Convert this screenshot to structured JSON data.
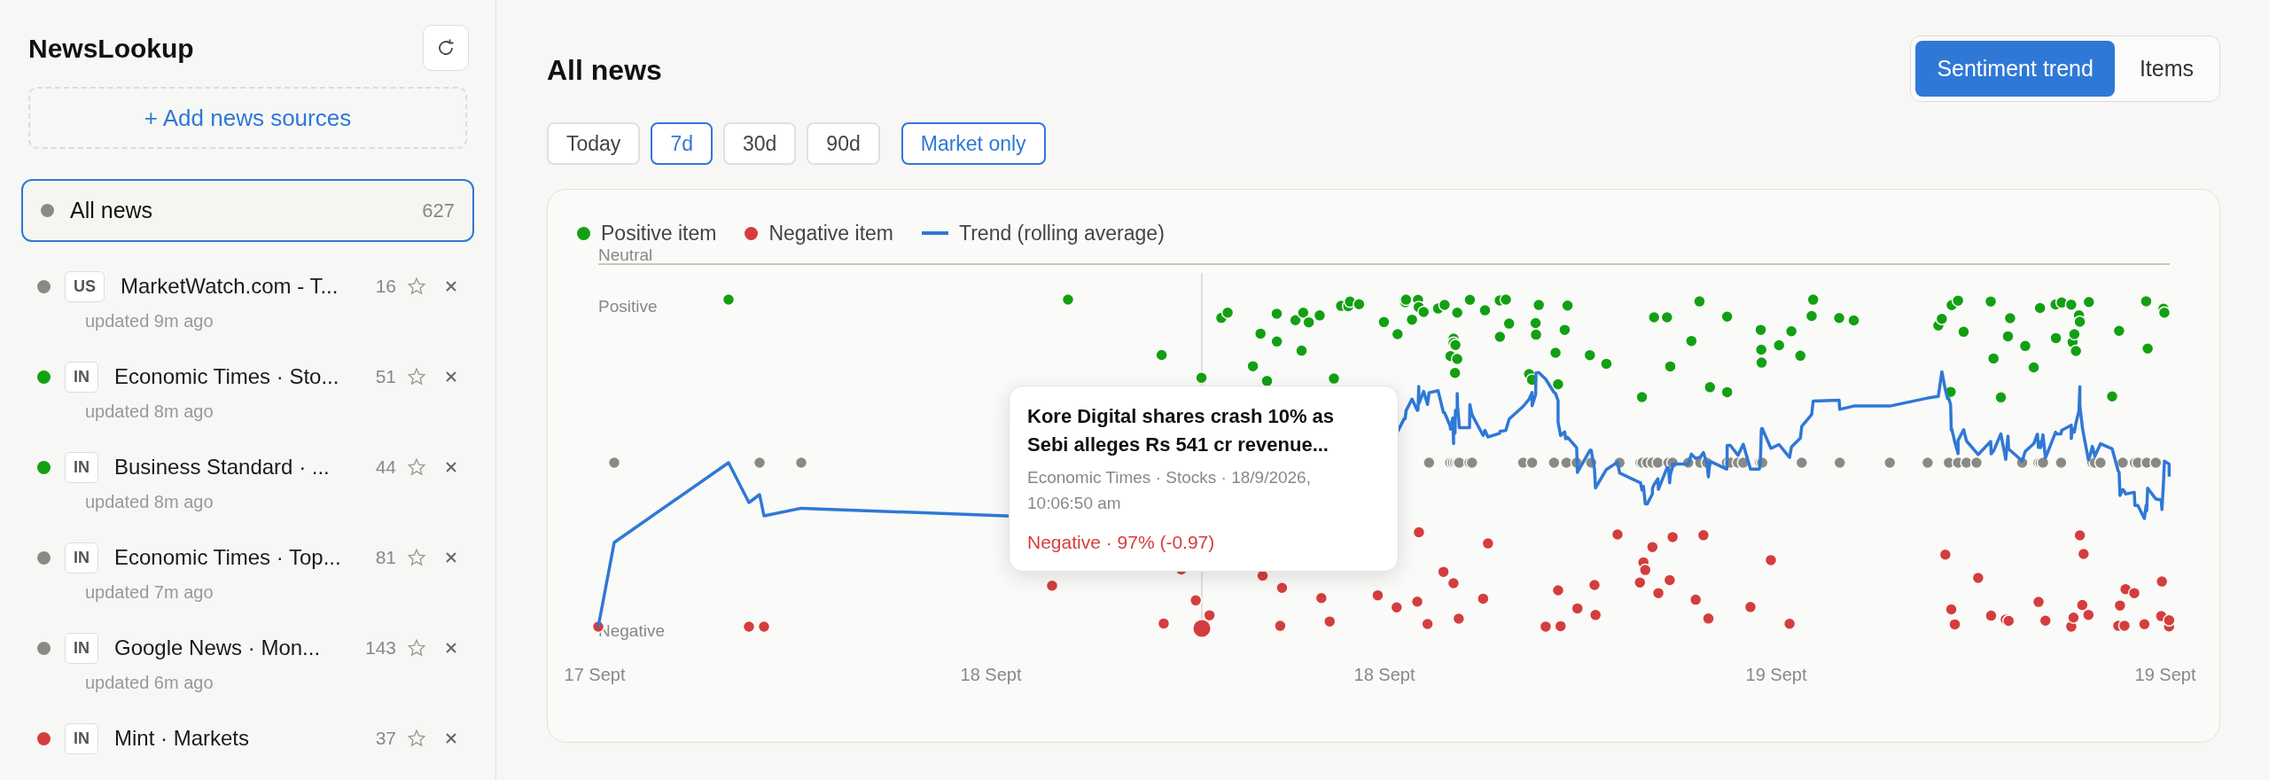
{
  "sidebar": {
    "title": "NewsLookup",
    "add_button": "+ Add news sources",
    "all_news": {
      "label": "All news",
      "count": "627",
      "selected": true,
      "color": "#8a8a85"
    },
    "sources": [
      {
        "region": "US",
        "name": "MarketWatch.com - T...",
        "count": "16",
        "updated": "updated 9m ago",
        "color": "#8a8a85",
        "selected": false,
        "starred": false
      },
      {
        "region": "IN",
        "name": "Economic Times · Sto...",
        "count": "51",
        "updated": "updated 8m ago",
        "color": "#12a012",
        "selected": false,
        "starred": false
      },
      {
        "region": "IN",
        "name": "Business Standard · ...",
        "count": "44",
        "updated": "updated 8m ago",
        "color": "#12a012",
        "selected": false,
        "starred": false
      },
      {
        "region": "IN",
        "name": "Economic Times · Top...",
        "count": "81",
        "updated": "updated 7m ago",
        "color": "#8a8a85",
        "selected": false,
        "starred": false
      },
      {
        "region": "IN",
        "name": "Google News · Mon...",
        "count": "143",
        "updated": "updated 6m ago",
        "color": "#8a8a85",
        "selected": false,
        "starred": false
      },
      {
        "region": "IN",
        "name": "Mint · Markets",
        "count": "37",
        "color": "#d43d3d",
        "selected": false,
        "starred": false
      }
    ]
  },
  "main": {
    "title": "All news",
    "view_tabs": [
      {
        "label": "Sentiment trend",
        "selected": true
      },
      {
        "label": "Items",
        "selected": false
      }
    ],
    "periods": [
      {
        "label": "Today",
        "selected": false
      },
      {
        "label": "7d",
        "selected": true
      },
      {
        "label": "30d",
        "selected": false
      },
      {
        "label": "90d",
        "selected": false
      }
    ],
    "market_only": {
      "label": "Market only",
      "on": true
    },
    "chart": {
      "legend": [
        {
          "kind": "dot",
          "label": "Positive item",
          "color": "#12a012"
        },
        {
          "kind": "dot",
          "label": "Negative item",
          "color": "#d43d3d"
        },
        {
          "kind": "line",
          "label": "Trend (rolling average)",
          "color": "#2f78d6"
        }
      ],
      "y_labels": {
        "top": "Neutral",
        "positive": "Positive",
        "negative": "Negative"
      },
      "x_ticks": [
        "17 Sept",
        "18 Sept",
        "18 Sept",
        "19 Sept",
        "19 Sept"
      ],
      "tooltip": {
        "title": "Kore Digital shares crash 10% as Sebi alleges Rs 541 cr revenue...",
        "meta": "Economic Times · Stocks · 18/9/2026, 10:06:50 am",
        "verdict": "Negative · 97% (-0.97)"
      }
    }
  }
}
